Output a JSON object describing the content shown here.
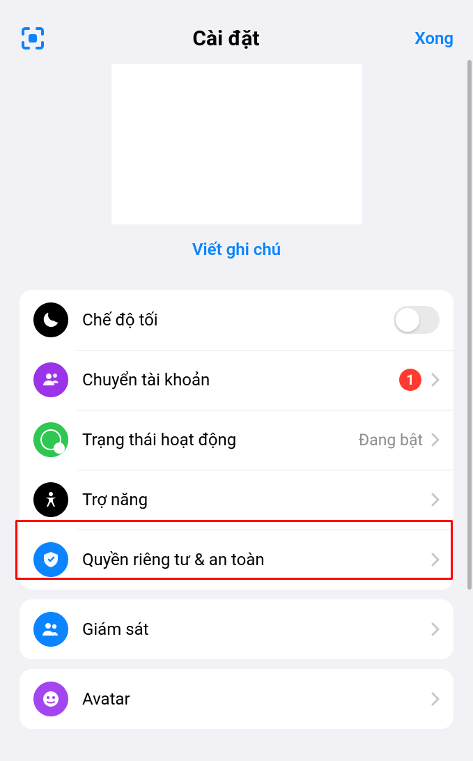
{
  "header": {
    "title": "Cài đặt",
    "done_label": "Xong"
  },
  "profile": {
    "note_label": "Viết ghi chú"
  },
  "group1": {
    "dark_mode": {
      "label": "Chế độ tối",
      "on": false
    },
    "switch_acct": {
      "label": "Chuyển tài khoản",
      "badge": "1"
    },
    "active_status": {
      "label": "Trạng thái hoạt động",
      "value": "Đang bật"
    },
    "accessibility": {
      "label": "Trợ năng"
    },
    "privacy": {
      "label": "Quyền riêng tư & an toàn"
    }
  },
  "group2": {
    "supervision": {
      "label": "Giám sát"
    }
  },
  "group3": {
    "avatar": {
      "label": "Avatar"
    }
  },
  "highlight_target": "privacy-row"
}
